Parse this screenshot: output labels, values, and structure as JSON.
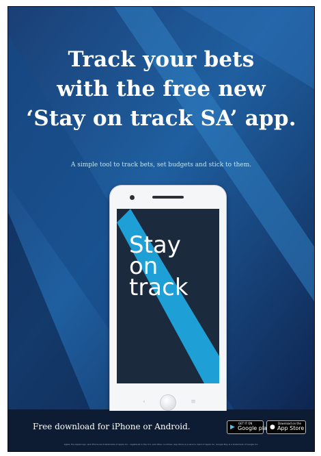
{
  "headline": {
    "line1": "Track your bets",
    "line2": "with the free new",
    "line3": "‘Stay on track SA’ app."
  },
  "subline": "A simple tool to track bets, set budgets and stick to them.",
  "phone": {
    "screen_lines": [
      "Stay",
      "on",
      "track"
    ],
    "back_glyph": "‹",
    "menu_glyph": "≡"
  },
  "footer": {
    "download_text": "Free download for iPhone or Android.",
    "google_badge": {
      "small": "GET IT ON",
      "big": "Google play",
      "icon": "▶"
    },
    "apple_badge": {
      "small": "Download on the",
      "big": "App Store",
      "icon": ""
    },
    "fineprint": "Apple, the Apple logo, and iPhone are trademarks of Apple Inc., registered in the U.S. and other countries. App Store is a service mark of Apple Inc. Google Play is a trademark of Google Inc."
  },
  "colors": {
    "background_dark": "#0b1b3a",
    "background_mid": "#1d4f86",
    "stripe_blue": "#1e9fd6",
    "screen_bg": "#1b2a3d"
  }
}
